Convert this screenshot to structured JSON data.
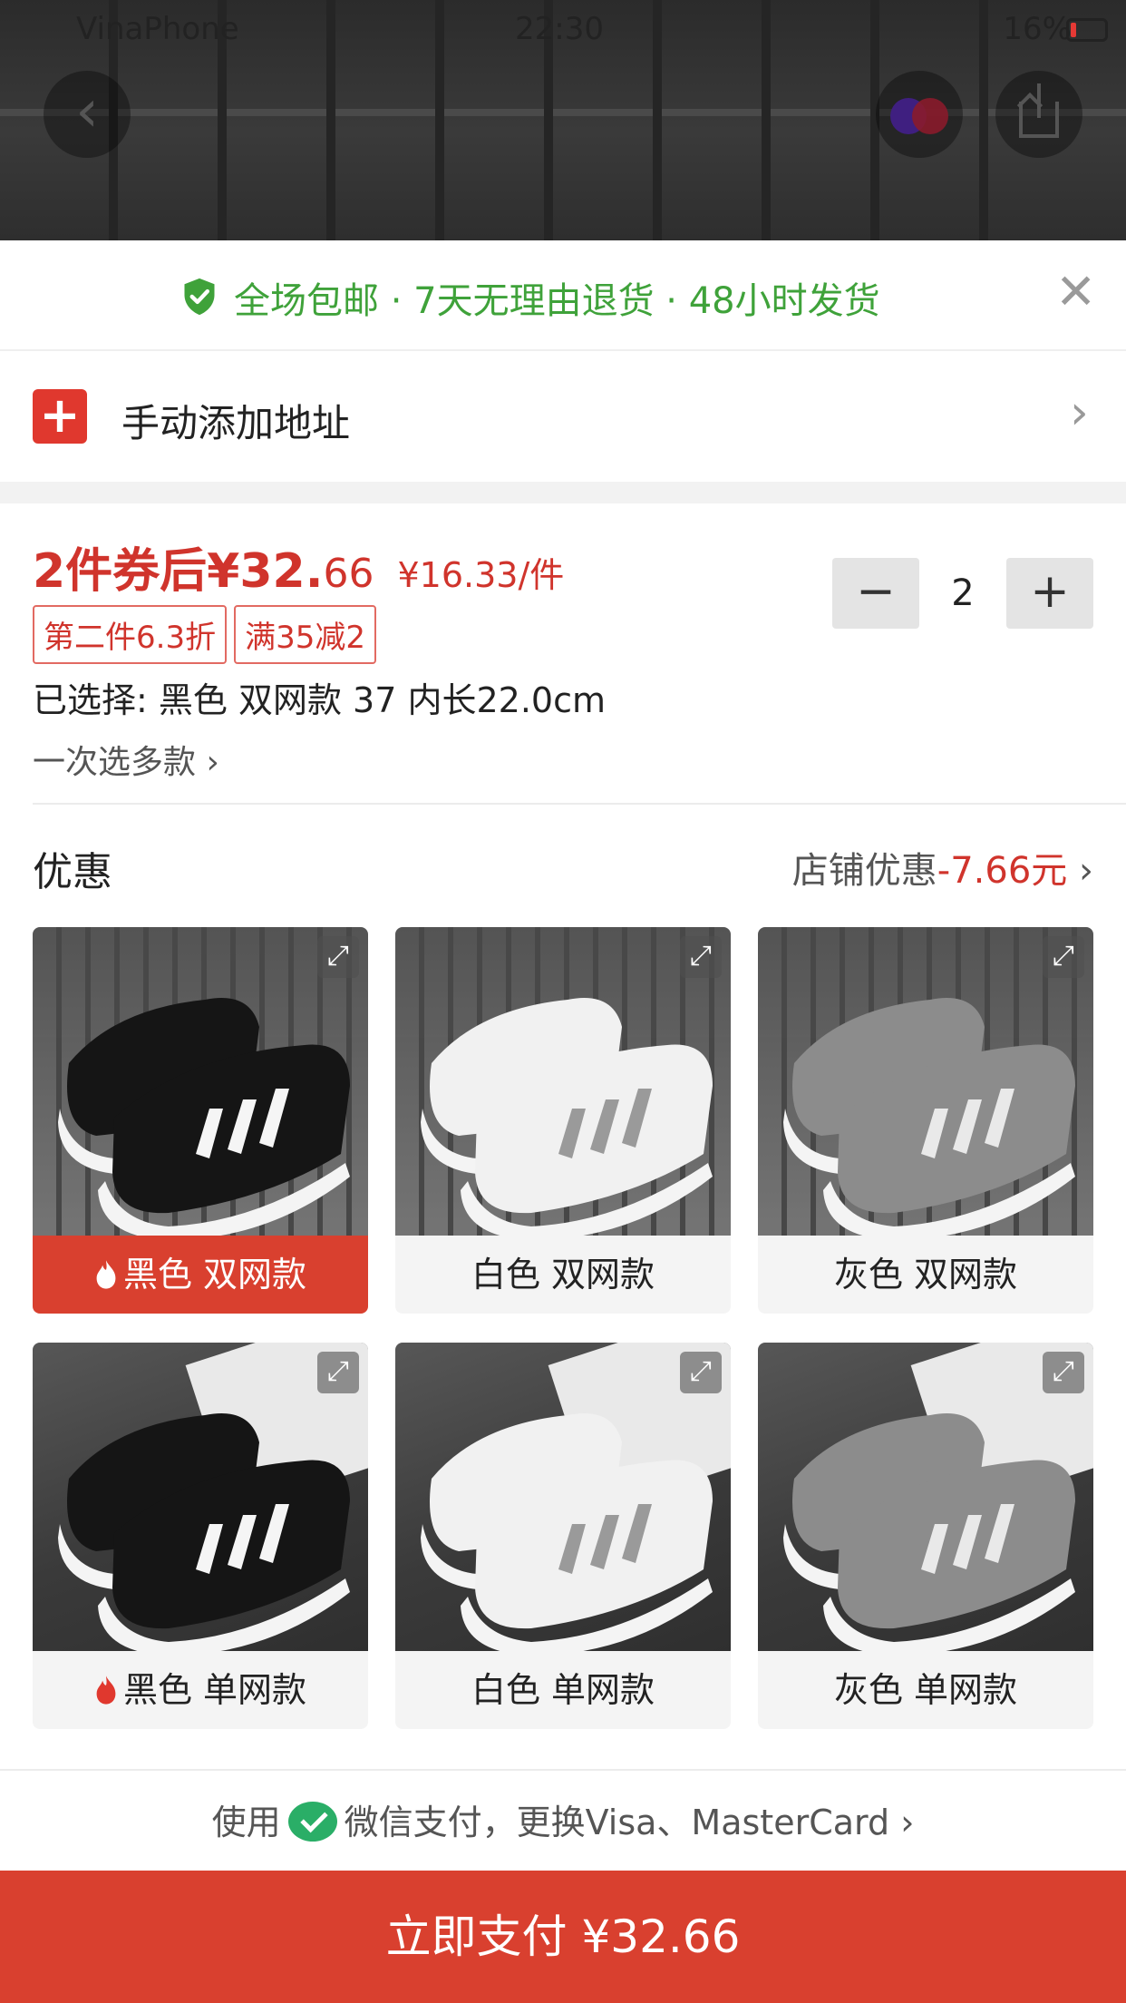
{
  "status_bar": {
    "carrier": "VinaPhone",
    "time": "22:30",
    "battery": "16%"
  },
  "promo": {
    "text": "全场包邮 · 7天无理由退货 · 48小时发货"
  },
  "address": {
    "label": "手动添加地址"
  },
  "price": {
    "main": "2件券后¥32.",
    "cents": "66",
    "unit_price": "¥16.33/件"
  },
  "quantity": {
    "minus": "−",
    "value": "2",
    "plus": "+"
  },
  "tags": [
    "第二件6.3折",
    "满35减2"
  ],
  "selected_text": "已选择: 黑色 双网款 37 内长22.0cm",
  "multi_select": "一次选多款",
  "discount": {
    "title": "优惠",
    "store_label": "店铺优惠",
    "amount": "-7.66元"
  },
  "variants": [
    {
      "label": "黑色 双网款",
      "color": "#151515",
      "active": true,
      "hot": true
    },
    {
      "label": "白色 双网款",
      "color": "#f1f1f1",
      "active": false,
      "hot": false
    },
    {
      "label": "灰色 双网款",
      "color": "#8c8c8c",
      "active": false,
      "hot": false
    },
    {
      "label": "黑色 单网款",
      "color": "#151515",
      "active": false,
      "hot": true
    },
    {
      "label": "白色 单网款",
      "color": "#f1f1f1",
      "active": false,
      "hot": false
    },
    {
      "label": "灰色 单网款",
      "color": "#8c8c8c",
      "active": false,
      "hot": false
    }
  ],
  "payment": {
    "prefix": "使用",
    "method": "微信支付，更换Visa、MasterCard"
  },
  "pay_button": "立即支付 ¥32.66",
  "colors": {
    "accent_red": "#d9402f",
    "promo_green": "#3fa23a",
    "wechat_green": "#2aae67"
  }
}
